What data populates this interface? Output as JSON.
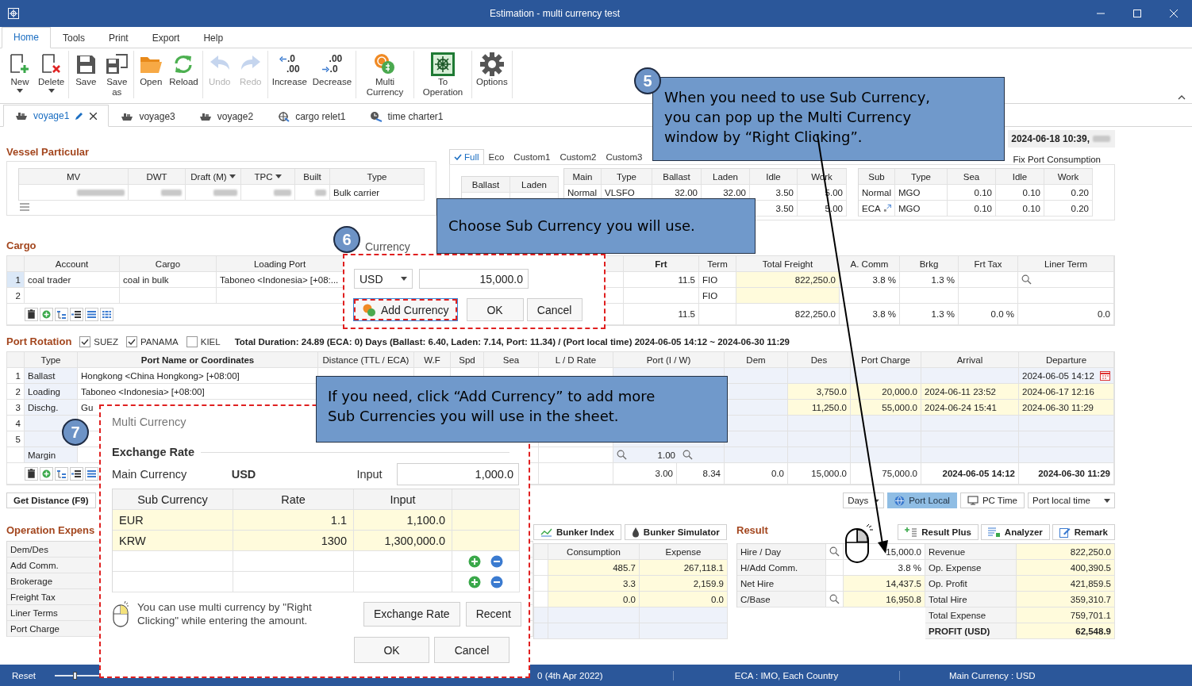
{
  "window": {
    "title": "Estimation - multi currency test"
  },
  "menu_tabs": [
    {
      "label": "Home",
      "selected": true
    },
    {
      "label": "Tools",
      "selected": false
    },
    {
      "label": "Print",
      "selected": false
    },
    {
      "label": "Export",
      "selected": false
    },
    {
      "label": "Help",
      "selected": false
    }
  ],
  "ribbon": [
    {
      "buttons": [
        {
          "label": "New",
          "kind": "new",
          "dropdown": true
        },
        {
          "label": "Delete",
          "kind": "delete",
          "dropdown": true
        }
      ]
    },
    {
      "buttons": [
        {
          "label": "Save",
          "kind": "save"
        },
        {
          "label": "Save as",
          "kind": "saveas"
        }
      ]
    },
    {
      "buttons": [
        {
          "label": "Open",
          "kind": "open"
        },
        {
          "label": "Reload",
          "kind": "reload"
        }
      ]
    },
    {
      "buttons": [
        {
          "label": "Undo",
          "kind": "undo",
          "disabled": true
        },
        {
          "label": "Redo",
          "kind": "redo",
          "disabled": true
        }
      ]
    },
    {
      "buttons": [
        {
          "label": "Increase",
          "kind": "increase",
          "icon_text": [
            ".0",
            ".00"
          ]
        },
        {
          "label": "Decrease",
          "kind": "decrease",
          "icon_text": [
            ".00",
            ".0"
          ]
        }
      ]
    },
    {
      "buttons": [
        {
          "label": "Multi Currency",
          "kind": "currency"
        }
      ]
    },
    {
      "buttons": [
        {
          "label": "To Operation",
          "kind": "operation"
        }
      ]
    },
    {
      "buttons": [
        {
          "label": "Options",
          "kind": "options"
        }
      ]
    }
  ],
  "document_tabs": [
    {
      "label": "voyage1",
      "kind": "voyage",
      "selected": true,
      "modified": true
    },
    {
      "label": "voyage3",
      "kind": "voyage",
      "selected": false,
      "modified": false
    },
    {
      "label": "voyage2",
      "kind": "voyage",
      "selected": false,
      "modified": false
    },
    {
      "label": "cargo relet1",
      "kind": "relet",
      "selected": false,
      "modified": false
    },
    {
      "label": "time charter1",
      "kind": "charter",
      "selected": false,
      "modified": false
    }
  ],
  "vessel_particular": {
    "title": "Vessel Particular",
    "columns": [
      {
        "label": "MV",
        "dropdown": false
      },
      {
        "label": "DWT",
        "dropdown": false
      },
      {
        "label": "Draft (M)",
        "dropdown": true
      },
      {
        "label": "TPC",
        "dropdown": true
      },
      {
        "label": "Built",
        "dropdown": false
      },
      {
        "label": "Type",
        "dropdown": false
      }
    ],
    "vessel_type": "Bulk carrier"
  },
  "consumption": {
    "timestamp": "2024-06-18 10:39,",
    "modes": [
      {
        "label": "Full",
        "selected": true
      },
      {
        "label": "Eco",
        "selected": false
      },
      {
        "label": "Custom1",
        "selected": false
      },
      {
        "label": "Custom2",
        "selected": false
      },
      {
        "label": "Custom3",
        "selected": false
      }
    ],
    "fix_label": "Fix Port Consumption",
    "speed_columns": [
      "Ballast",
      "Laden"
    ],
    "main_columns": [
      "Main",
      "Type",
      "Ballast",
      "Laden",
      "Idle",
      "Work"
    ],
    "main_rows": [
      [
        "Normal",
        "VLSFO",
        "32.00",
        "32.00",
        "3.50",
        "5.00"
      ],
      [
        "",
        "",
        "",
        "",
        "3.50",
        "5.00"
      ]
    ],
    "sub_columns": [
      "Sub",
      "Type",
      "Sea",
      "Idle",
      "Work"
    ],
    "sub_rows": [
      {
        "cells": [
          "Normal",
          "MGO",
          "0.10",
          "0.10",
          "0.20"
        ]
      },
      {
        "cells": [
          "ECA",
          "MGO",
          "0.10",
          "0.10",
          "0.20"
        ],
        "icon": true
      }
    ]
  },
  "cargo": {
    "title": "Cargo",
    "columns": [
      "Account",
      "Cargo",
      "Loading Port",
      "Frt",
      "Term",
      "Total Freight",
      "A. Comm",
      "Brkg",
      "Frt Tax",
      "Liner Term"
    ],
    "rows": [
      {
        "num": "1",
        "selected": true,
        "search": true,
        "cells": [
          "coal trader",
          "coal in bulk",
          "Taboneo <Indonesia> [+08:...",
          "11.5",
          "FIO",
          "822,250.0",
          "3.8 %",
          "1.3 %",
          "",
          ""
        ]
      },
      {
        "num": "2",
        "selected": false,
        "search": false,
        "cells": [
          "",
          "",
          "",
          "",
          "FIO",
          "",
          "",
          "",
          "",
          ""
        ]
      }
    ],
    "totals": {
      "frt": "11.5",
      "total_freight": "822,250.0",
      "a_comm": "3.8 %",
      "brkg": "1.3 %",
      "frt_tax": "0.0 %",
      "liner_term": "0.0"
    }
  },
  "port_rotation": {
    "title": "Port Rotation",
    "canals": [
      {
        "label": "SUEZ",
        "checked": true
      },
      {
        "label": "PANAMA",
        "checked": true
      },
      {
        "label": "KIEL",
        "checked": false
      }
    ],
    "summary": "Total Duration: 24.89 (ECA: 0) Days (Ballast: 6.40, Laden: 7.14, Port: 11.34) / (Port local time) 2024-06-05 14:12 ~ 2024-06-30 11:29",
    "columns": [
      "Type",
      "Port Name or Coordinates",
      "Distance (TTL / ECA)",
      "W.F",
      "Spd",
      "Sea",
      "L / D Rate",
      "Port (I / W)",
      "Dem",
      "Des",
      "Port Charge",
      "Arrival",
      "Departure"
    ],
    "rows": [
      {
        "num": "1",
        "highlight": false,
        "calendar": true,
        "cells": [
          "Ballast",
          "Hongkong <China Hongkong> [+08:00]",
          "",
          "",
          "",
          "",
          "",
          "",
          "",
          "",
          "",
          "",
          "2024-06-05 14:12"
        ]
      },
      {
        "num": "2",
        "highlight": true,
        "calendar": false,
        "cells": [
          "Loading",
          "Taboneo <Indonesia> [+08:00]",
          "",
          "",
          "",
          "",
          "",
          "",
          "",
          "3,750.0",
          "20,000.0",
          "2024-06-11 23:52",
          "2024-06-17 12:16"
        ]
      },
      {
        "num": "3",
        "highlight": true,
        "calendar": false,
        "cells": [
          "Dischg.",
          "Gu",
          "",
          "",
          "",
          "",
          "",
          "",
          "",
          "11,250.0",
          "55,000.0",
          "2024-06-24 15:41",
          "2024-06-30 11:29"
        ]
      },
      {
        "num": "4",
        "highlight": false,
        "calendar": false,
        "cells": [
          "",
          "",
          "",
          "",
          "",
          "",
          "",
          "",
          "",
          "",
          "",
          "",
          ""
        ]
      },
      {
        "num": "5",
        "highlight": false,
        "calendar": false,
        "cells": [
          "",
          "",
          "",
          "",
          "",
          "",
          "",
          "",
          "",
          "",
          "",
          "",
          ""
        ]
      },
      {
        "num": "",
        "highlight": false,
        "calendar": false,
        "cells": [
          "Margin",
          "",
          "",
          "",
          "",
          "",
          "",
          "1.00",
          "",
          "",
          "",
          "",
          ""
        ]
      }
    ],
    "totals": {
      "port_in": "3.00",
      "port_work": "8.34",
      "dem": "0.0",
      "des": "15,000.0",
      "port_charge": "75,000.0",
      "arrival": "2024-06-05 14:12",
      "departure": "2024-06-30 11:29"
    }
  },
  "get_distance": "Get Distance (F9)",
  "time_controls": {
    "unit": "Days",
    "modes": [
      {
        "label": "Port Local",
        "selected": true
      },
      {
        "label": "PC Time",
        "selected": false
      }
    ],
    "zone": "Port local time"
  },
  "operation_expenses": {
    "title": "Operation Expens",
    "rows": [
      "Dem/Des",
      "Add Comm.",
      "Brokerage",
      "Freight Tax",
      "Liner Terms",
      "Port Charge"
    ]
  },
  "bunker": {
    "buttons": [
      "Bunker Index",
      "Bunker Simulator"
    ],
    "columns": [
      "Consumption",
      "Expense"
    ],
    "rows": [
      {
        "highlight": true,
        "cells": [
          "485.7",
          "267,118.1"
        ]
      },
      {
        "highlight": true,
        "cells": [
          "3.3",
          "2,159.9"
        ]
      },
      {
        "highlight": true,
        "cells": [
          "0.0",
          "0.0"
        ]
      },
      {
        "highlight": false,
        "cells": [
          "",
          ""
        ]
      },
      {
        "highlight": false,
        "cells": [
          "",
          ""
        ]
      }
    ]
  },
  "result": {
    "title": "Result",
    "buttons": [
      "Result Plus",
      "Analyzer",
      "Remark"
    ],
    "hire": [
      {
        "label": "Hire / Day",
        "search": true,
        "value": "15,000.0",
        "highlight": false
      },
      {
        "label": "H/Add Comm.",
        "search": false,
        "value": "3.8 %",
        "highlight": false
      },
      {
        "label": "Net Hire",
        "search": false,
        "value": "14,437.5",
        "highlight": true
      },
      {
        "label": "C/Base",
        "search": true,
        "value": "16,950.8",
        "highlight": true
      }
    ],
    "totals": [
      {
        "label": "Revenue",
        "value": "822,250.0",
        "total": false
      },
      {
        "label": "Op. Expense",
        "value": "400,390.5",
        "total": false
      },
      {
        "label": "Op. Profit",
        "value": "421,859.5",
        "total": false
      },
      {
        "label": "Total Hire",
        "value": "359,310.7",
        "total": false
      },
      {
        "label": "Total Expense",
        "value": "759,701.1",
        "total": false
      },
      {
        "label": "PROFIT (USD)",
        "value": "62,548.9",
        "total": true
      }
    ]
  },
  "status_bar": {
    "reset": "Reset",
    "zoom_slider": {
      "level": 0.42
    },
    "version": "0 (4th Apr 2022)",
    "eca": "ECA : IMO, Each Country",
    "currency": "Main Currency : USD"
  },
  "callouts": [
    {
      "number": "5",
      "text": "When you need to use Sub Currency,\nyou can pop up the Multi Currency\nwindow by “Right Clicking”."
    },
    {
      "text": "Choose Sub Currency you will use."
    },
    {
      "text": "If you need, click “Add Currency” to add more\nSub Currencies you will use in the sheet."
    }
  ],
  "currency_popup": {
    "number": "6",
    "label": "Currency",
    "currency": "USD",
    "amount": "15,000.0",
    "add_button": "Add Currency",
    "ok": "OK",
    "cancel": "Cancel"
  },
  "multi_currency": {
    "number": "7",
    "title": "Multi Currency",
    "section": "Exchange Rate",
    "main_label": "Main Currency",
    "main_currency": "USD",
    "input_label": "Input",
    "input_value": "1,000.0",
    "columns": [
      "Sub Currency",
      "Rate",
      "Input"
    ],
    "rows": [
      {
        "cells": [
          "EUR",
          "1.1",
          "1,100.0"
        ],
        "filled": true
      },
      {
        "cells": [
          "KRW",
          "1300",
          "1,300,000.0"
        ],
        "filled": true
      },
      {
        "cells": [
          "",
          "",
          ""
        ],
        "filled": false
      },
      {
        "cells": [
          "",
          "",
          ""
        ],
        "filled": false
      }
    ],
    "hint": "You can use multi currency by \"Right Clicking\" while entering the amount.",
    "buttons": [
      "Exchange Rate",
      "Recent"
    ],
    "ok": "OK",
    "cancel": "Cancel"
  }
}
